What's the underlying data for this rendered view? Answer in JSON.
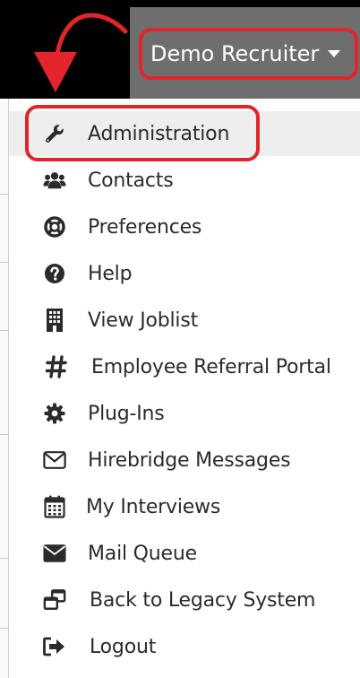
{
  "header": {
    "user_name": "Demo Recruiter"
  },
  "menu": {
    "items": [
      {
        "label": "Administration",
        "icon": "wrench-icon"
      },
      {
        "label": "Contacts",
        "icon": "users-icon"
      },
      {
        "label": "Preferences",
        "icon": "life-ring-icon"
      },
      {
        "label": "Help",
        "icon": "question-circle-icon"
      },
      {
        "label": "View Joblist",
        "icon": "building-icon"
      },
      {
        "label": "Employee Referral Portal",
        "icon": "hashtag-icon"
      },
      {
        "label": "Plug-Ins",
        "icon": "gear-icon"
      },
      {
        "label": "Hirebridge Messages",
        "icon": "envelope-outline-icon"
      },
      {
        "label": "My Interviews",
        "icon": "calendar-icon"
      },
      {
        "label": "Mail Queue",
        "icon": "envelope-icon"
      },
      {
        "label": "Back to Legacy System",
        "icon": "window-restore-icon"
      },
      {
        "label": "Logout",
        "icon": "sign-out-icon"
      }
    ]
  },
  "colors": {
    "annotation_red": "#e3242b",
    "topbar": "#000000",
    "user_area": "#6e6e6e",
    "icon": "#2b2b2b"
  }
}
